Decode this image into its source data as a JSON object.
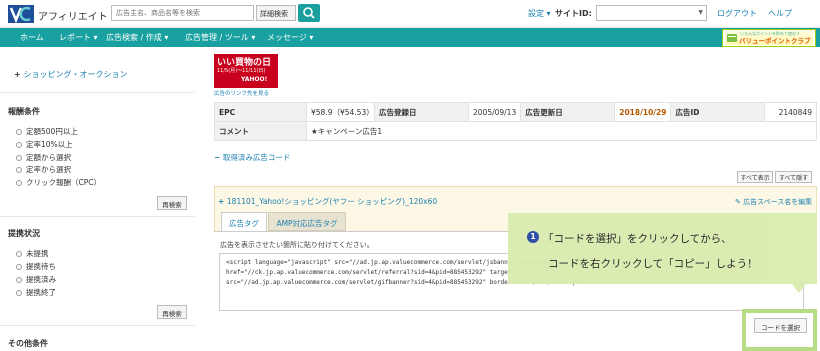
{
  "header": {
    "brand": "アフィリエイト",
    "search_placeholder": "広告主名、商品名等を検索",
    "search_mode": "詳細検索",
    "settings_label": "設定",
    "site_id_label": "サイトID:",
    "site_id_value": "",
    "logout_label": "ログアウト",
    "help_label": "ヘルプ"
  },
  "nav": {
    "items": [
      {
        "label": "ホーム"
      },
      {
        "label": "レポート ▾"
      },
      {
        "label": "広告検索 / 作成 ▾"
      },
      {
        "label": "広告管理 / ツール ▾"
      },
      {
        "label": "メッセージ ▾"
      }
    ],
    "banner": {
      "text": "バリューポイントクラブ",
      "sub": "いろんなポイントを貯めて使おう"
    }
  },
  "sidebar": {
    "category_link": "ショッピング・オークション",
    "reward": {
      "title": "報酬条件",
      "options": [
        "定額500円以上",
        "定率10%以上",
        "定額から選択",
        "定率から選択",
        "クリック報酬（CPC）"
      ],
      "button": "再検索"
    },
    "status": {
      "title": "提携状況",
      "options": [
        "未提携",
        "提携待ち",
        "提携済み",
        "提携終了"
      ],
      "button": "再検索"
    },
    "other_title": "その他条件"
  },
  "ad": {
    "banner_line1": "いい買物の日",
    "banner_line2": "11/5(月)〜11/11(日)",
    "banner_line3": "YAHOO!",
    "link_text": "広告のリンク先を見る"
  },
  "info": {
    "row1": {
      "epc_label": "EPC",
      "epc_value": "¥58.9（¥54.53）",
      "registered_label": "広告登録日",
      "registered_value": "2005/09/13",
      "updated_label": "広告更新日",
      "updated_value": "2018/10/29",
      "id_label": "広告ID",
      "id_value": "2140849"
    },
    "row2": {
      "comment_label": "コメント",
      "comment_value": "★キャンペーン広告1"
    }
  },
  "code_section": {
    "fetched_label": "取得済み広告コード",
    "show_all": "すべて表示",
    "collapse_all": "すべて隠す",
    "title": "181101_Yahoo!ショッピング(ヤフー ショッピング)_120x60",
    "space_link": "広告スペース名を編集",
    "tab_active": "広告タグ",
    "tab_amp": "AMP対応広告タグ",
    "hint": "広告を表示させたい箇所に貼り付けてください。",
    "code_line1": "<script language=\"javascript\" src=\"//ad.jp.ap.valuecommerce.com/servlet/jsbanner?sid=4&pid=",
    "code_line2": "href=\"//ck.jp.ap.valuecommerce.com/servlet/referral?sid=4&pid=885453292\" target",
    "code_line3": "src=\"//ad.jp.ap.valuecommerce.com/servlet/gifbanner?sid=4&pid=885453292\" border=\"0\"></a></noscript>",
    "select_button": "コードを選択"
  },
  "callout": {
    "number": "1",
    "line1": "「コードを選択」をクリックしてから、",
    "line2": "コードを右クリックして「コピー」しよう！"
  }
}
